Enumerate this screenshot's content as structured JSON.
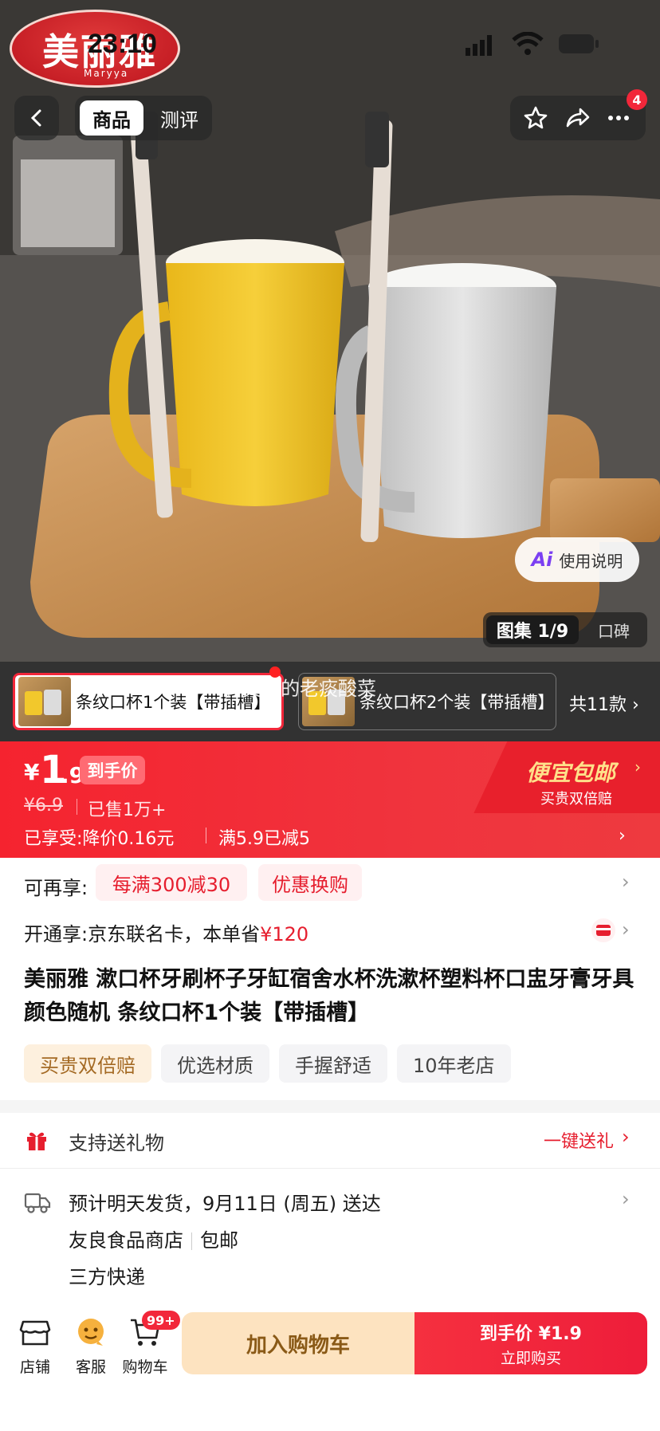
{
  "status_bar": {
    "time": "23:10"
  },
  "brand": {
    "logo_text": "美丽雅",
    "logo_sub": "Maryya"
  },
  "nav": {
    "tab_active": "商品",
    "tab_review": "测评",
    "more_badge": "4"
  },
  "hero": {
    "usage_label": "使用说明",
    "ai_label": "Ai",
    "gallery_label": "图集 1/9",
    "review_label": "口碑",
    "watermark": "脚尖上的老痰酸菜"
  },
  "sku": {
    "items": [
      {
        "label": "条纹口杯1个装【带插槽】",
        "selected": true
      },
      {
        "label": "条纹口杯2个装【带插槽】",
        "selected": false
      }
    ],
    "total": "共11款 ›"
  },
  "price": {
    "currency": "¥",
    "integer": "1",
    "decimal": ".9",
    "tag": "到手价",
    "original": "¥6.9",
    "sold": "已售1万+",
    "enjoyed_1": "已享受:降价0.16元",
    "enjoyed_2": "满5.9已减5",
    "free_ship": "便宜包邮",
    "free_ship_sub": "买贵双倍赔"
  },
  "more_offers": {
    "label": "可再享:",
    "chips": [
      "每满300减30",
      "优惠换购"
    ]
  },
  "card_offer": {
    "label": "开通享:京东联名卡，本单省",
    "amount": "¥120"
  },
  "product": {
    "title": "美丽雅 漱口杯牙刷杯子牙缸宿舍水杯洗漱杯塑料杯口盅牙膏牙具颜色随机 条纹口杯1个装【带插槽】",
    "tags": [
      {
        "label": "买贵双倍赔",
        "style": "gold"
      },
      {
        "label": "优选材质",
        "style": "gray"
      },
      {
        "label": "手握舒适",
        "style": "gray"
      },
      {
        "label": "10年老店",
        "style": "gray"
      }
    ]
  },
  "gift": {
    "label": "支持送礼物",
    "link": "一键送礼"
  },
  "shipping": {
    "delivery": "预计明天发货，9月11日 (周五) 送达",
    "shop": "友良食品商店",
    "shipping_fee": "包邮",
    "courier": "三方快递"
  },
  "bottom": {
    "shop": "店铺",
    "service": "客服",
    "cart": "购物车",
    "cart_badge": "99+",
    "add_cart": "加入购物车",
    "buy_main": "到手价 ¥1.9",
    "buy_sub": "立即购买"
  },
  "colors": {
    "accent": "#f2273a",
    "gold_tag_bg": "#fdf0de",
    "add_cart_bg": "#fde3c0"
  }
}
